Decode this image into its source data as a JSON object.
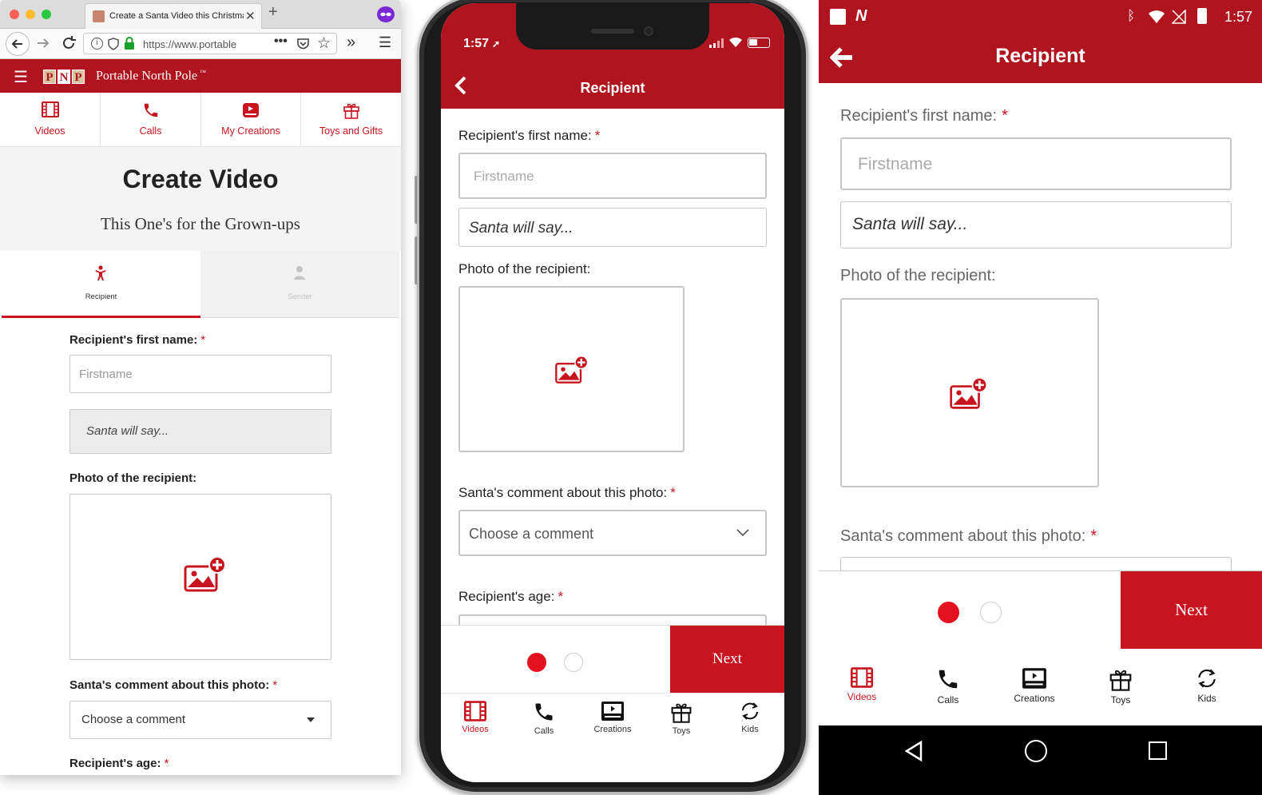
{
  "browser": {
    "tab_title": "Create a Santa Video this Christmas",
    "url": "https://www.portable",
    "logo_letters": [
      "P",
      "N",
      "P"
    ],
    "site_name": "Portable North Pole",
    "site_name_tm": "™",
    "nav": [
      {
        "label": "Videos",
        "icon": "film-icon"
      },
      {
        "label": "Calls",
        "icon": "phone-icon"
      },
      {
        "label": "My Creations",
        "icon": "creations-icon"
      },
      {
        "label": "Toys and Gifts",
        "icon": "gift-icon"
      }
    ],
    "page_title": "Create Video",
    "page_subtitle": "This One's for the Grown-ups",
    "tabs": [
      {
        "label": "Recipient",
        "active": true,
        "icon": "recipient-icon"
      },
      {
        "label": "Sender",
        "active": false,
        "icon": "sender-icon"
      }
    ],
    "form": {
      "first_name_label": "Recipient's first name:",
      "required_mark": "*",
      "first_name_placeholder": "Firstname",
      "santa_say": "Santa will say...",
      "photo_label": "Photo of the recipient:",
      "comment_label": "Santa's comment about this photo:",
      "comment_placeholder": "Choose a comment",
      "age_label": "Recipient's age:"
    }
  },
  "ios": {
    "time": "1:57",
    "title": "Recipient",
    "form": {
      "first_name_label": "Recipient's first name:",
      "required_mark": "*",
      "first_name_placeholder": "Firstname",
      "santa_say": "Santa will say...",
      "photo_label": "Photo of the recipient:",
      "comment_label": "Santa's comment about this photo:",
      "comment_placeholder": "Choose a comment",
      "age_label": "Recipient's age:"
    },
    "next_label": "Next",
    "tabs": [
      {
        "label": "Videos",
        "icon": "film-icon",
        "active": true
      },
      {
        "label": "Calls",
        "icon": "phone-icon",
        "active": false
      },
      {
        "label": "Creations",
        "icon": "creations-icon",
        "active": false
      },
      {
        "label": "Toys",
        "icon": "gift-icon",
        "active": false
      },
      {
        "label": "Kids",
        "icon": "refresh-icon",
        "active": false
      }
    ]
  },
  "android": {
    "time": "1:57",
    "title": "Recipient",
    "form": {
      "first_name_label": "Recipient's first name:",
      "required_mark": "*",
      "first_name_placeholder": "Firstname",
      "santa_say": "Santa will say...",
      "photo_label": "Photo of the recipient:",
      "comment_label": "Santa's comment about this photo:"
    },
    "next_label": "Next",
    "tabs": [
      {
        "label": "Videos",
        "icon": "film-icon",
        "active": true
      },
      {
        "label": "Calls",
        "icon": "phone-icon",
        "active": false
      },
      {
        "label": "Creations",
        "icon": "creations-icon",
        "active": false
      },
      {
        "label": "Toys",
        "icon": "gift-icon",
        "active": false
      },
      {
        "label": "Kids",
        "icon": "refresh-icon",
        "active": false
      }
    ]
  },
  "colors": {
    "brand_red": "#b0151f",
    "accent_red": "#c8141e"
  }
}
